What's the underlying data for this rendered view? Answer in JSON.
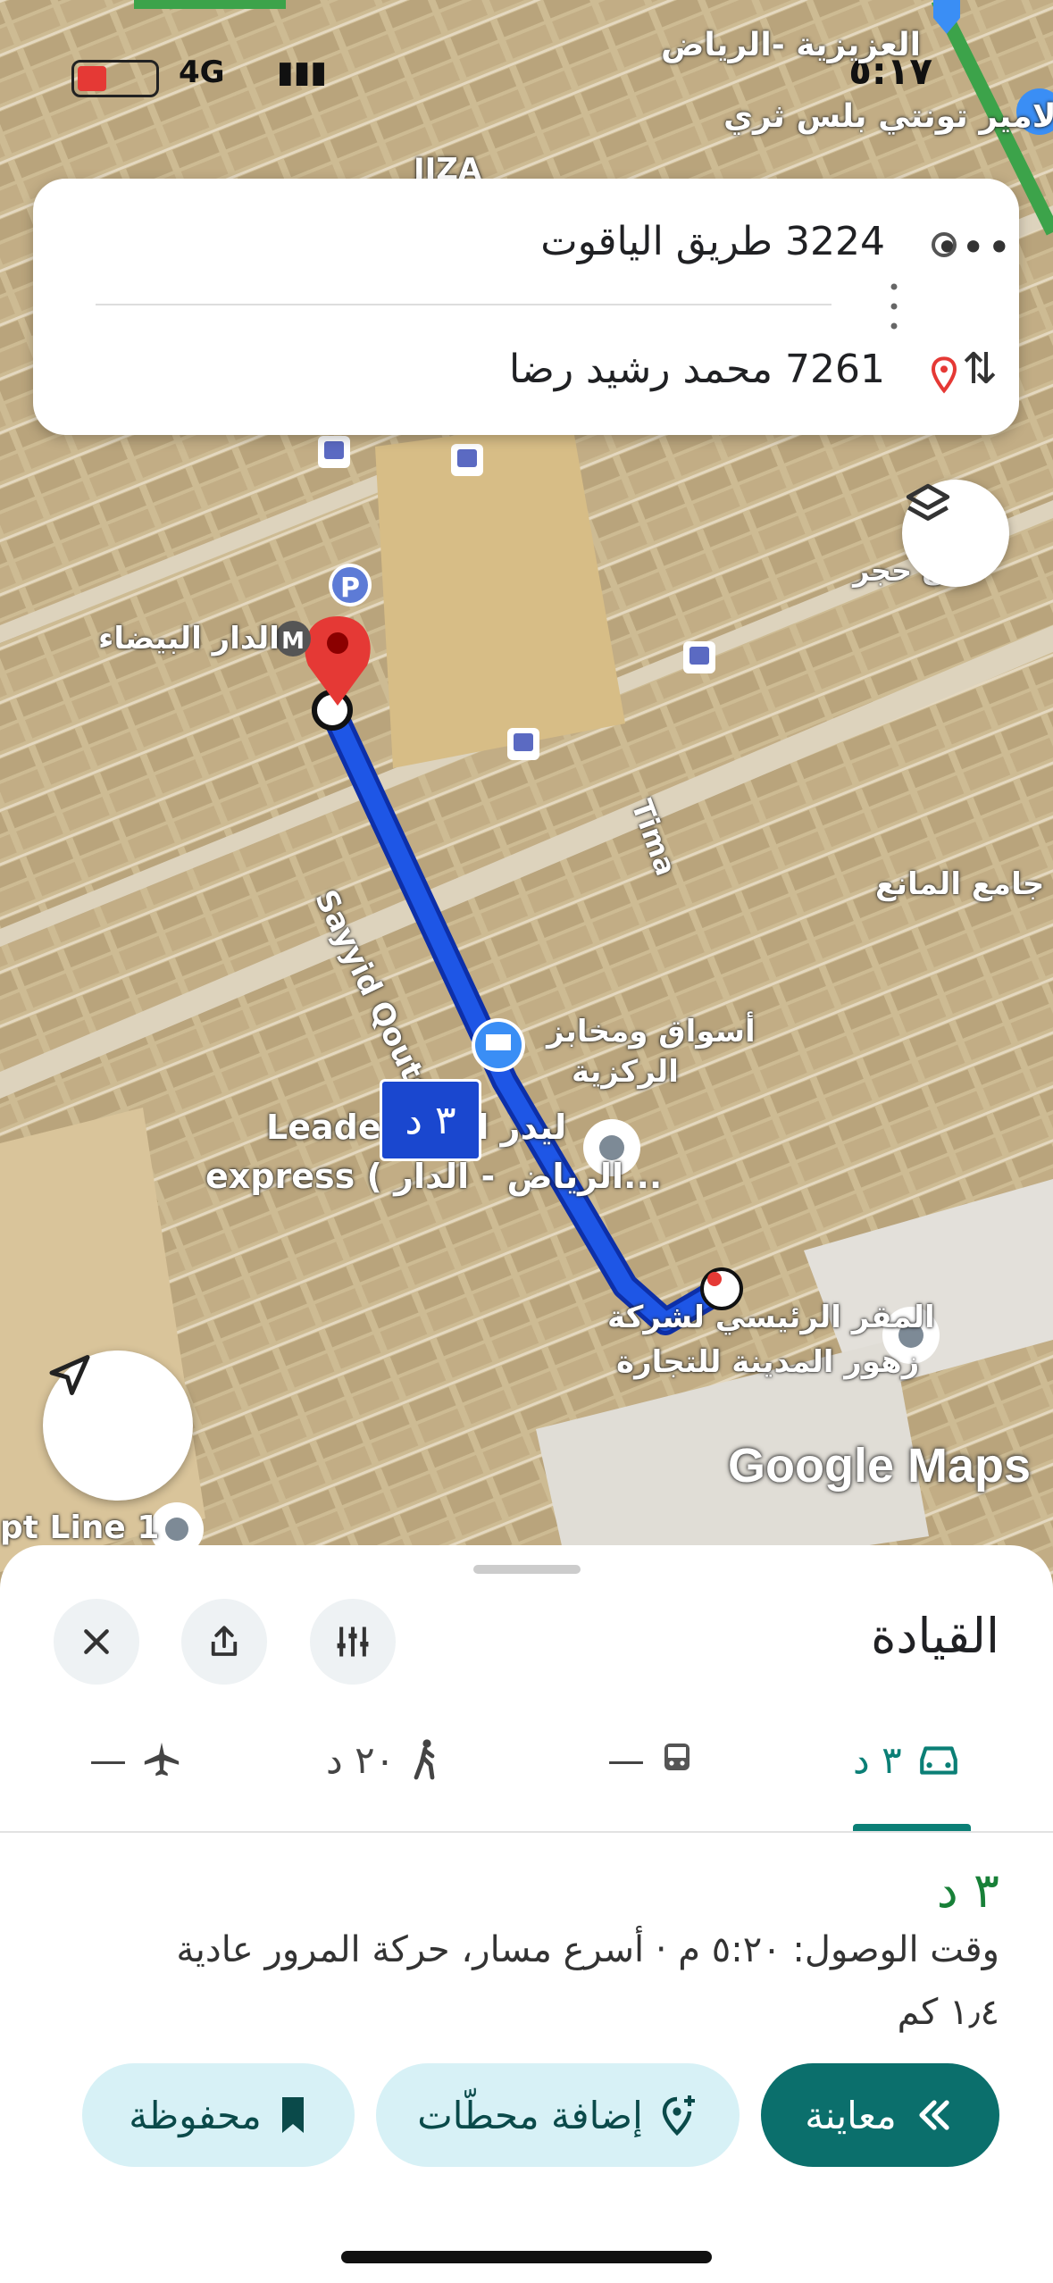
{
  "status_bar": {
    "time": "٥:١٧",
    "network": "4G"
  },
  "route_card": {
    "origin": "3224 طريق الياقوت",
    "destination": "7261 محمد رشيد رضا",
    "more_label": "•••",
    "swap_label": "⇅"
  },
  "map": {
    "labels": {
      "top_area": "العزيزية -الرياض",
      "top_store": "الامير تونتي بلس ثري",
      "jiza": "JIZA",
      "dar_baida": "الدار البيضاء",
      "street_sayyid": "Sayyid Qoutoub",
      "street_tima": "Tima",
      "mosque": "جامع المانع",
      "market_1": "أسواق ومخابز",
      "market_2": "الركزية",
      "leader_1": "Leader ليدر اكس",
      "leader_2": "express ( الرياض - الدار...",
      "hq_1": "المقر الرئيسي لشركة",
      "hq_2": "زهور المدينة للتجارة",
      "spot_line": "pt Line 1",
      "hajar": "ن حجر"
    },
    "route_time": "٣ د",
    "watermark": "Google Maps",
    "parking": "P",
    "metro": "M"
  },
  "sheet": {
    "title": "القيادة",
    "modes": {
      "car": "٣ د",
      "transit": "—",
      "walk": "٢٠ د",
      "fly": "—"
    },
    "duration": "٣ د",
    "eta": "وقت الوصول: ٥:٢٠ م · أسرع مسار، حركة المرور عادية",
    "distance": "١٫٤ كم",
    "buttons": {
      "preview": "معاينة",
      "add_stops": "إضافة محطّات",
      "saved": "محفوظة"
    }
  },
  "colors": {
    "route": "#1a47cf",
    "accent": "#0b7f76",
    "pin": "#e53935"
  }
}
